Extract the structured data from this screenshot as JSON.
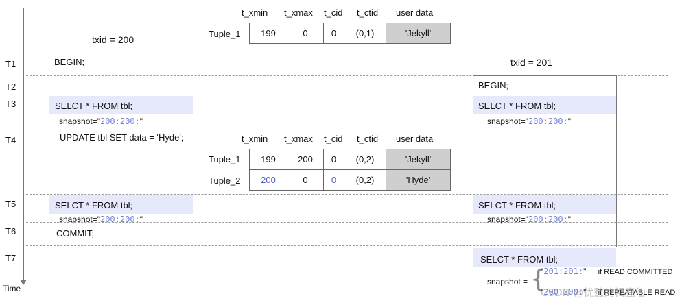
{
  "columns": [
    "t_xmin",
    "t_xmax",
    "t_cid",
    "t_ctid",
    "user data"
  ],
  "top_table": {
    "rows": [
      {
        "name": "Tuple_1",
        "xmin": "199",
        "xmax": "0",
        "cid": "0",
        "ctid": "(0,1)",
        "data": "'Jekyll'"
      }
    ]
  },
  "mid_table": {
    "rows": [
      {
        "name": "Tuple_1",
        "xmin": "199",
        "xmax": "200",
        "cid": "0",
        "ctid": "(0,2)",
        "data": "'Jekyll'"
      },
      {
        "name": "Tuple_2",
        "xmin": "200",
        "xmax": "0",
        "cid": "0",
        "ctid": "(0,2)",
        "data": "'Hyde'"
      }
    ]
  },
  "tx_left": {
    "label": "txid = 200",
    "begin": "BEGIN;",
    "select1": "SELCT * FROM tbl;",
    "snap_prefix": "snapshot=\"",
    "snap_value": "200:200:",
    "snap_suffix": "\"",
    "update": "UPDATE tbl SET data = 'Hyde';",
    "select2": "SELCT * FROM tbl;",
    "commit": "COMMIT;"
  },
  "tx_right": {
    "label": "txid = 201",
    "begin": "BEGIN;",
    "select1": "SELCT * FROM tbl;",
    "select2": "SELCT * FROM tbl;",
    "select3": "SELCT * FROM tbl;",
    "snap_prefix": "snapshot=\"",
    "snap_value": "200:200:",
    "snap_suffix": "\"",
    "snapshot_label": "snapshot =",
    "opt1_value": "201:201:",
    "opt1_mode": "if READ COMMITTED",
    "opt2_value": "200:200:",
    "opt2_mode": "if REPEATABLE READ"
  },
  "time_labels": [
    "T1",
    "T2",
    "T3",
    "T4",
    "T5",
    "T6",
    "T7"
  ],
  "time_axis_label": "Time",
  "watermark": "CSDN @忧愁的褐鹿仙",
  "colors": {
    "highlight_band": "#e6e8fb",
    "grey_cell": "#cfcfcf",
    "snapshot_blue": "#6f7fd9"
  }
}
